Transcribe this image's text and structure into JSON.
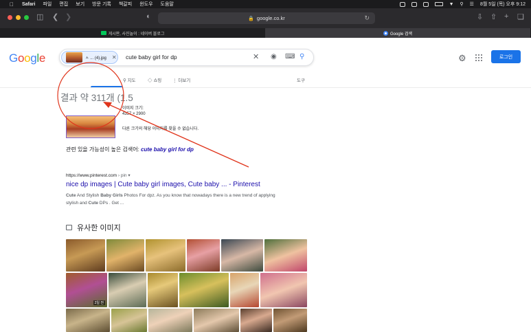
{
  "menubar": {
    "app": "Safari",
    "items": [
      "파일",
      "편집",
      "보기",
      "방문 기록",
      "책갈피",
      "윈도우",
      "도움말"
    ],
    "datetime": "8월 5일 (목) 오후 9:12"
  },
  "toolbar": {
    "url": "google.co.kr"
  },
  "tabs": [
    {
      "label": "게시판, 사진놀이 : 네이버 블로그",
      "active": false,
      "favicon_color": "#03c75a"
    },
    {
      "label": "Google 검색",
      "active": true,
      "favicon_color": "#4285f4"
    }
  ],
  "google": {
    "logo": "Google",
    "chip_filename": "ㅅ ... (4).jpg",
    "query": "cute baby girl for dp",
    "login_label": "로그인",
    "tabs": [
      "지도",
      "쇼핑",
      "더보기"
    ],
    "tools_label": "도구"
  },
  "results": {
    "count_text": "결과 약 311개 (1.5",
    "image_size_label": "이미지 크기:",
    "image_size_value": "4357 × 2900",
    "no_other_sizes": "다른 크기의 해당 이미지를 찾을 수 없습니다.",
    "related_prefix": "관련 있을 가능성이 높은 검색어:",
    "related_query": "cute baby girl for dp",
    "site_url": "https://www.pinterest.com",
    "site_path": " › pin ▾",
    "result_title": "nice dp images | Cute baby girl images, Cute baby ... - Pinterest",
    "snippet_parts": [
      "Cute",
      " And Stylish ",
      "Baby Girls",
      " Photos For dpz. As you know that nowadays there is a new trend of applying stylish and ",
      "Cute",
      " DPs . Get ..."
    ],
    "similar_heading": "유사한 이미지",
    "badge": "2일 전"
  },
  "colors": {
    "accent": "#1a73e8",
    "link": "#1a0dab",
    "annotation": "#e0351c"
  }
}
